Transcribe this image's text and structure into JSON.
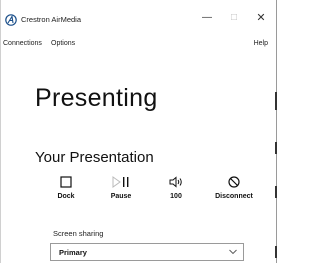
{
  "window": {
    "title": "Crestron AirMedia",
    "minimize_glyph": "—",
    "maximize_glyph": "□",
    "close_glyph": "✕"
  },
  "menu": {
    "connections": "Connections",
    "options": "Options",
    "help": "Help"
  },
  "status": {
    "heading": "Presenting"
  },
  "presentation": {
    "heading": "Your Presentation",
    "controls": {
      "dock": {
        "label": "Dock",
        "icon": "dock-square-icon"
      },
      "pause": {
        "label": "Pause",
        "icon": "play-pause-icon"
      },
      "volume": {
        "label": "100",
        "icon": "speaker-icon"
      },
      "disconnect": {
        "label": "Disconnect",
        "icon": "prohibited-icon"
      }
    }
  },
  "screen_sharing": {
    "label": "Screen sharing",
    "selected": "Primary"
  }
}
